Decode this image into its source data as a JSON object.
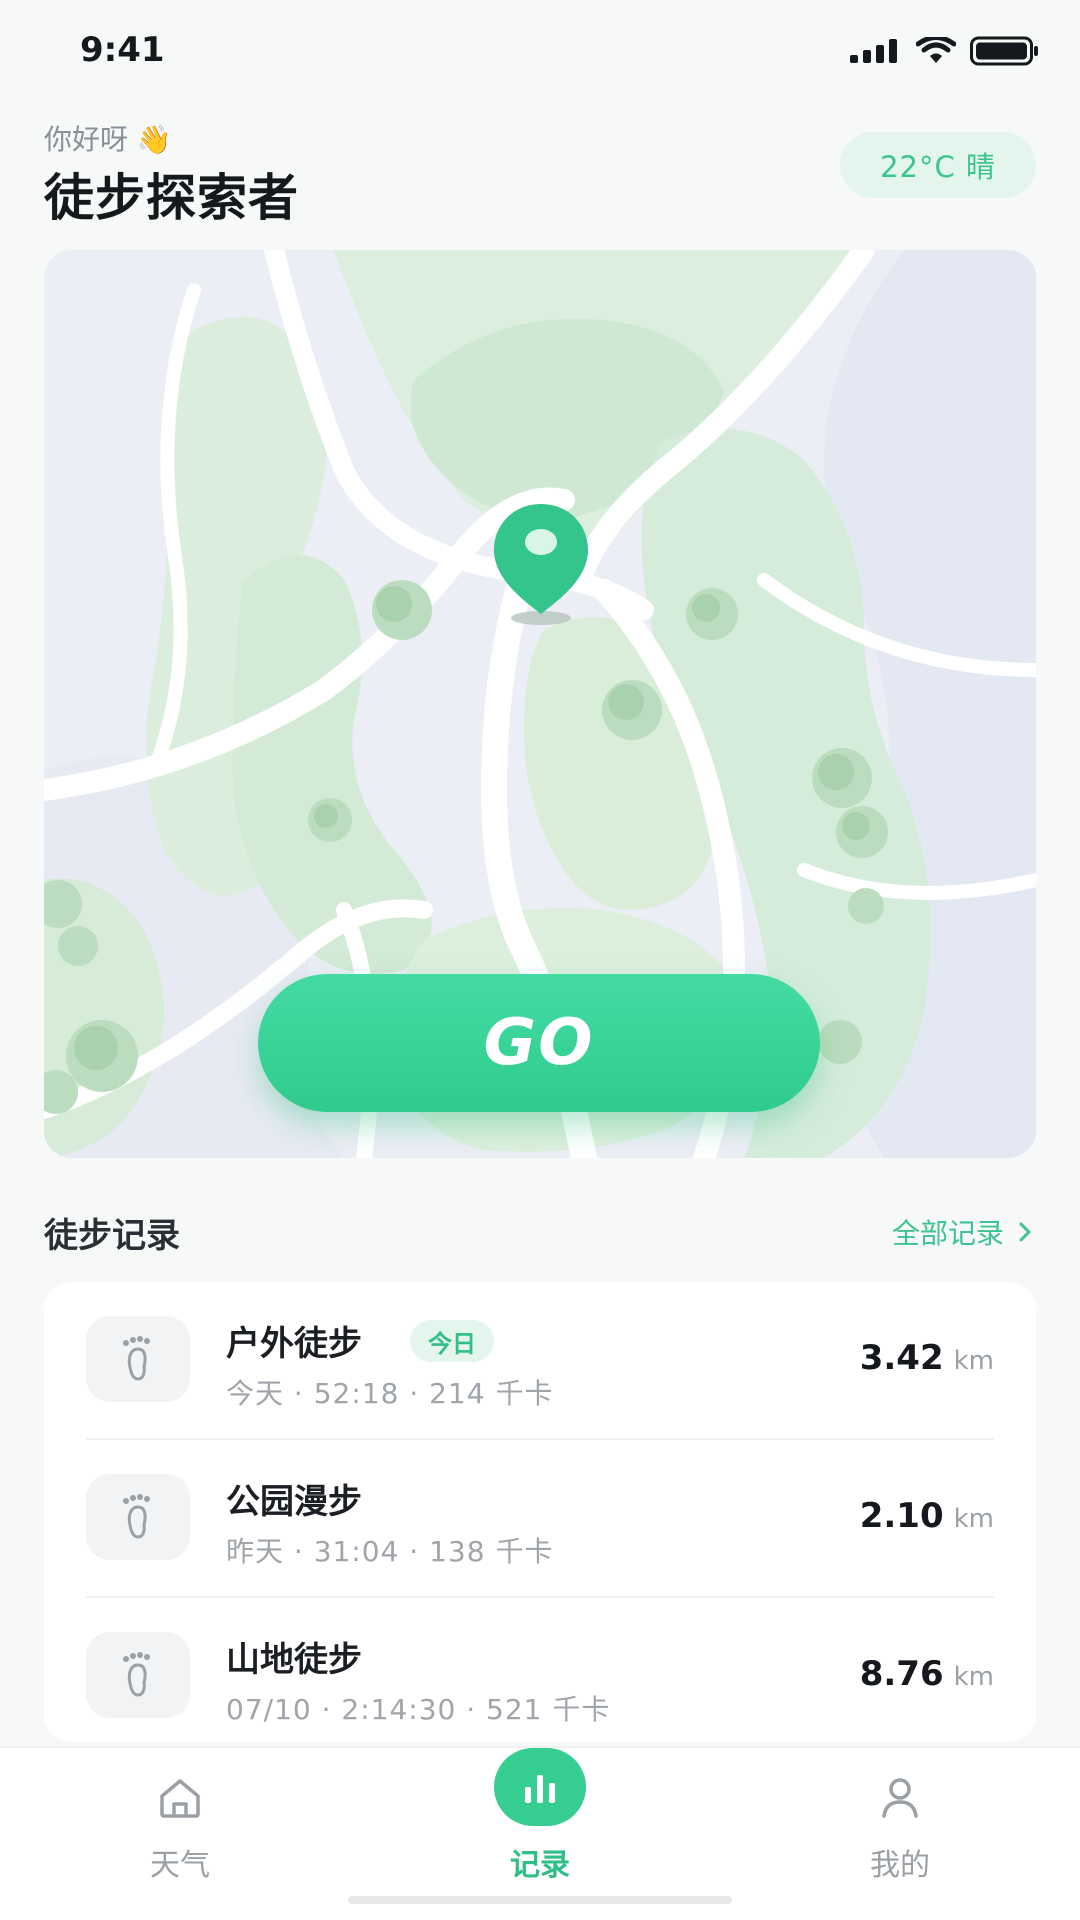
{
  "status_bar": {
    "time": "9:41",
    "icons": [
      "signal-icon",
      "wifi-icon",
      "battery-icon"
    ]
  },
  "header": {
    "greeting": "你好呀 👋",
    "title": "徒步探索者",
    "weather": "22°C 晴"
  },
  "map": {
    "pin_icon": "location-pin-icon",
    "go_label": "GO",
    "accent_color": "#35cd90"
  },
  "records_section": {
    "title": "徒步记录",
    "view_all": "全部记录",
    "items": [
      {
        "name": "户外徒步",
        "badge": "今日",
        "meta": "今天 · 52:18 · 214 千卡",
        "distance": "3.42",
        "unit": "km",
        "icon": "footprint-icon"
      },
      {
        "name": "公园漫步",
        "badge": "",
        "meta": "昨天 · 31:04 · 138 千卡",
        "distance": "2.10",
        "unit": "km",
        "icon": "footprint-icon"
      },
      {
        "name": "山地徒步",
        "badge": "",
        "meta": "07/10 · 2:14:30 · 521 千卡",
        "distance": "8.76",
        "unit": "km",
        "icon": "footprint-icon"
      }
    ]
  },
  "tab_bar": {
    "tabs": [
      {
        "label": "天气",
        "icon": "home-icon",
        "active": false
      },
      {
        "label": "记录",
        "icon": "bar-chart-icon",
        "active": true
      },
      {
        "label": "我的",
        "icon": "user-icon",
        "active": false
      }
    ]
  }
}
